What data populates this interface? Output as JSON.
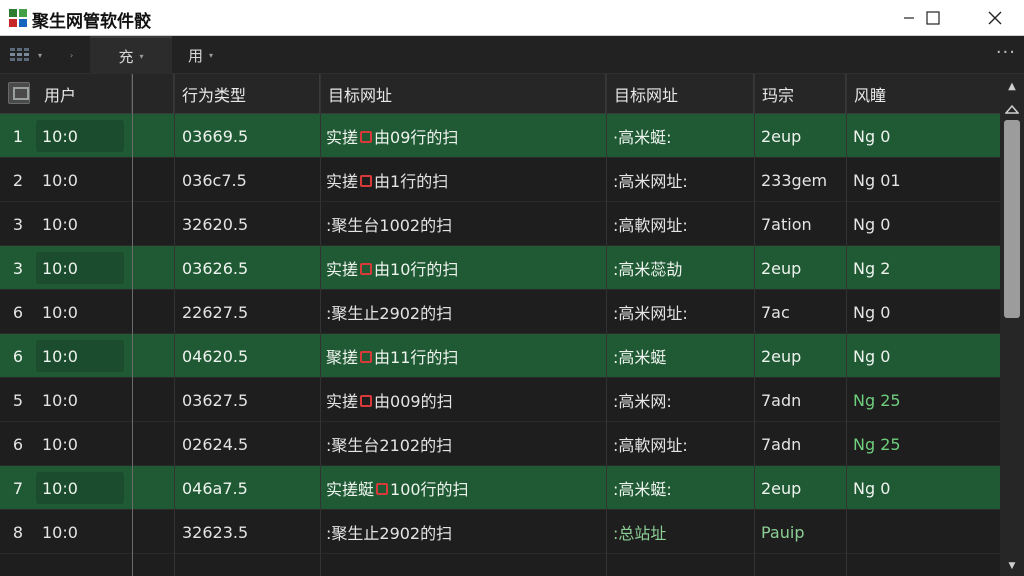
{
  "window": {
    "title": "聚生网管软件骹",
    "buttons": {
      "minimize": "minimize",
      "maximize": "maximize",
      "close": "close"
    }
  },
  "toolbar": {
    "items": [
      {
        "label": "",
        "icon": "grid-icon"
      },
      {
        "label": "",
        "icon": "chevron-right-icon"
      },
      {
        "label": "充"
      },
      {
        "label": "用"
      }
    ],
    "more": "···"
  },
  "columns": {
    "user": "用户",
    "type": "行为类型",
    "target1": "目标网址",
    "target2": "目标网址",
    "a": "玛宗",
    "b": "风瞳"
  },
  "rows": [
    {
      "num": "1",
      "user": "10:0",
      "type": "03669.5",
      "t1a": "实搓",
      "t1b": "由",
      "t1c": "09行的扫",
      "t2": "·高米蜓:",
      "a": "2eup",
      "b": "Ng 0",
      "hl": true
    },
    {
      "num": "2",
      "user": "10:0",
      "type": "036c7.5",
      "t1a": "实搓",
      "t1b": "由",
      "t1c": "1行的扫",
      "t2": ":高米网址:",
      "a": "233gem",
      "b": "Ng 01",
      "hl": false
    },
    {
      "num": "3",
      "user": "10:0",
      "type": "32620.5",
      "t1a": ":聚生台1002的扫",
      "t1b": "",
      "t1c": "",
      "t2": ":高軟网址:",
      "a": "7ation",
      "b": "Ng 0",
      "hl": false
    },
    {
      "num": "3",
      "user": "10:0",
      "type": "03626.5",
      "t1a": "实搓",
      "t1b": "由",
      "t1c": "10行的扫",
      "t2": ":高米蕊劼",
      "a": "2eup",
      "b": "Ng 2",
      "hl": true
    },
    {
      "num": "6",
      "user": "10:0",
      "type": "22627.5",
      "t1a": ":聚生止2902的扫",
      "t1b": "",
      "t1c": "",
      "t2": ":高米网址:",
      "a": "7ac",
      "b": "Ng 0",
      "hl": false
    },
    {
      "num": "6",
      "user": "10:0",
      "type": "04620.5",
      "t1a": "聚搓",
      "t1b": "由",
      "t1c": "11行的扫",
      "t2": ":高米蜓",
      "a": "2eup",
      "b": "Ng 0",
      "hl": true
    },
    {
      "num": "5",
      "user": "10:0",
      "type": "03627.5",
      "t1a": "实搓",
      "t1b": "由",
      "t1c": "009的扫",
      "t2": ":高米网:",
      "a": "7adn",
      "b": "Ng 25",
      "hl": false
    },
    {
      "num": "6",
      "user": "10:0",
      "type": "02624.5",
      "t1a": ":聚生台2102的扫",
      "t1b": "",
      "t1c": "",
      "t2": ":高軟网址:",
      "a": "7adn",
      "b": "Ng 25",
      "hl": false
    },
    {
      "num": "7",
      "user": "10:0",
      "type": "046a7.5",
      "t1a": "实搓蜓",
      "t1b": "",
      "t1c": "100行的扫",
      "t2": ":高米蜓:",
      "a": "2eup",
      "b": "Ng 0",
      "hl": true
    },
    {
      "num": "8",
      "user": "10:0",
      "type": "32623.5",
      "t1a": ":聚生止2902的扫",
      "t1b": "",
      "t1c": "",
      "t2": ":总站址",
      "a": "Pauip",
      "b": "",
      "hl": false
    }
  ],
  "colors": {
    "row_highlight": "#1f5a34",
    "accent_green": "#6fcf7d",
    "lock_red": "#d83a3a"
  }
}
